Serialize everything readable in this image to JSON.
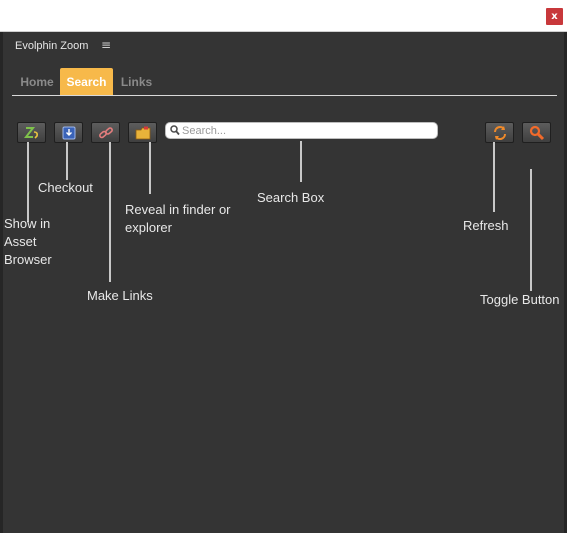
{
  "window": {
    "close_label": "x"
  },
  "panel": {
    "title": "Evolphin Zoom",
    "menu_icon": "≡"
  },
  "tabs": [
    {
      "label": "Home",
      "active": false
    },
    {
      "label": "Search",
      "active": true
    },
    {
      "label": "Links",
      "active": false
    }
  ],
  "toolbar": {
    "buttons": [
      {
        "icon": "asset-browser-icon"
      },
      {
        "icon": "checkout-icon"
      },
      {
        "icon": "link-icon"
      },
      {
        "icon": "folder-icon"
      },
      {
        "icon": "refresh-icon"
      },
      {
        "icon": "search-icon"
      }
    ]
  },
  "search": {
    "placeholder": "Search..."
  },
  "callouts": {
    "show_in_asset_browser": "Show in Asset Browser",
    "checkout": "Checkout",
    "reveal_in_finder": "Reveal in finder or explorer",
    "search_box": "Search Box",
    "make_links": "Make Links",
    "refresh": "Refresh",
    "toggle_button": "Toggle Button"
  },
  "colors": {
    "accent": "#f7b94a",
    "panel_bg": "#343434",
    "close_button": "#c8383b",
    "toggle_icon": "#f26a2a"
  }
}
